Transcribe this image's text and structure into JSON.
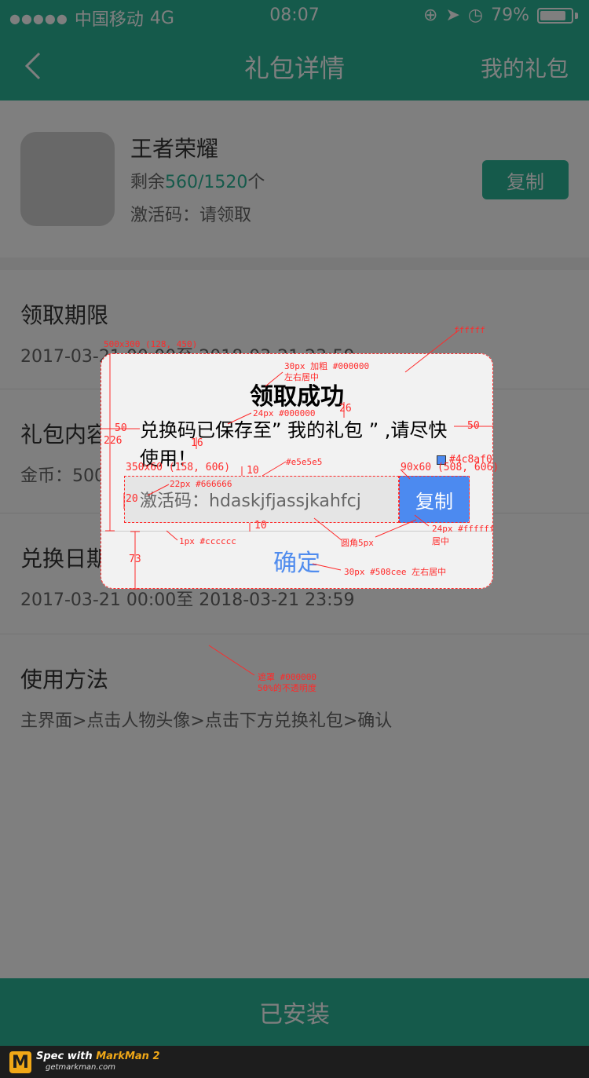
{
  "status_bar": {
    "carrier": "中国移动",
    "network": "4G",
    "time": "08:07",
    "battery": "79%"
  },
  "nav": {
    "title": "礼包详情",
    "right": "我的礼包"
  },
  "gift": {
    "name": "王者荣耀",
    "remain_prefix": "剩余",
    "remain_num": "560/1520",
    "remain_suffix": "个",
    "code": "激活码：请领取",
    "copy": "复制"
  },
  "sections": [
    {
      "title": "领取期限",
      "body": "2017-03-21 00:00至 2018-03-21 23:59"
    },
    {
      "title": "礼包内容",
      "body": "金币：5000、钻石：200、经验：2000"
    },
    {
      "title": "兑换日期",
      "body": "2017-03-21 00:00至 2018-03-21 23:59"
    },
    {
      "title": "使用方法",
      "body": "主界面>点击人物头像>点击下方兑换礼包>确认"
    }
  ],
  "bottom_button": "已安装",
  "markman": {
    "line1a": "Spec with",
    "line1b": "MarkMan 2",
    "line2": "getmarkman.com"
  },
  "dialog": {
    "title": "领取成功",
    "message": "兑换码已保存至” 我的礼包 ” ,请尽快使用！",
    "code": "激活码：hdaskjfjassjkahfcj",
    "copy": "复制",
    "ok": "确定"
  },
  "annotations": {
    "dialog_size": "500x300 (128, 450)",
    "bg_color": "ffffff",
    "title_spec": "30px 加粗 #000000",
    "title_align": "左右居中",
    "msg_spec": "24px #000000",
    "gap_26": "26",
    "gap_16": "16",
    "gap_50_left": "50",
    "gap_50_right": "50",
    "gap_226": "226",
    "code_color": "#e5e5e5",
    "code_box": "350x60 (158, 606)",
    "gap_10_top": "10",
    "copy_color": "#4c8af0",
    "copy_box": "90x60 (508, 606)",
    "code_spec": "22px #666666",
    "gap_20": "20",
    "gap_10_bottom": "10",
    "line_spec": "1px #cccccc",
    "radius": "圆角5px",
    "copy_spec": "24px #ffffff",
    "copy_align": "居中",
    "gap_73": "73",
    "ok_spec": "30px #508cee 左右居中",
    "mask_spec": "遮罩 #000000",
    "mask_opacity": "50%的不透明度"
  }
}
